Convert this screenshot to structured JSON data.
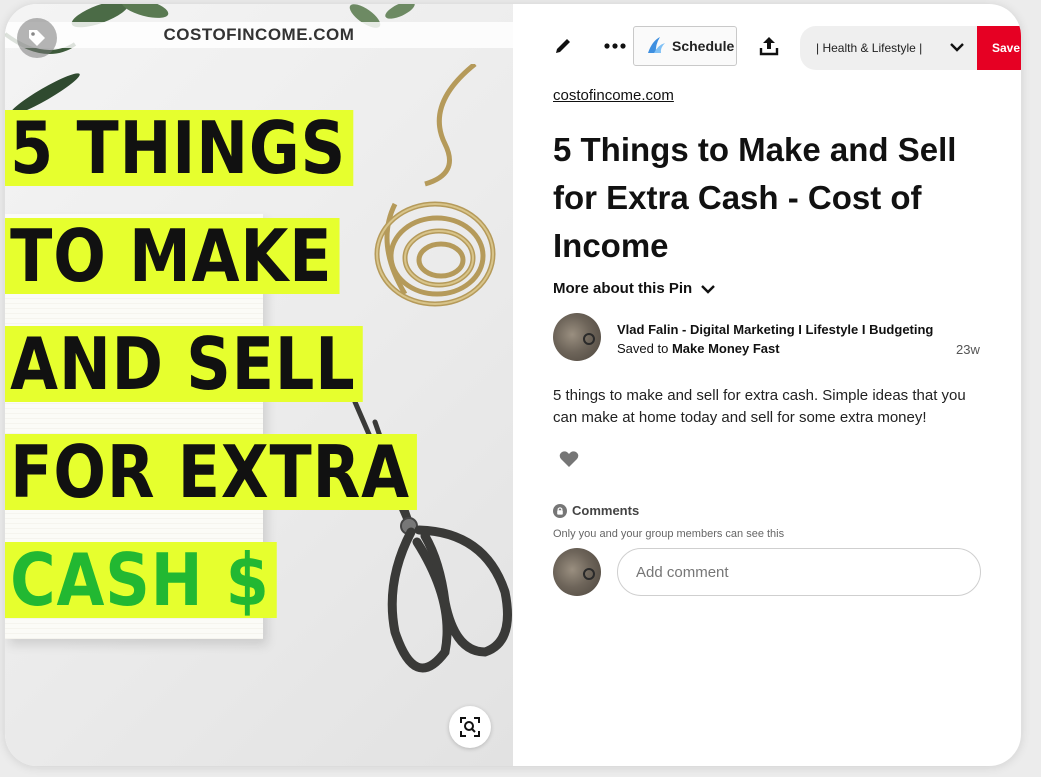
{
  "image": {
    "site_banner": "COSTOFINCOME.COM",
    "headline_lines": [
      "5 THINGS",
      "TO MAKE",
      "AND SELL",
      "FOR EXTRA",
      "CASH $"
    ],
    "highlight_color": "#e6ff2e",
    "accent_green": "#22b832"
  },
  "toolbar": {
    "edit_icon": "pencil-icon",
    "more_icon": "ellipsis-icon",
    "schedule_label": "Schedule",
    "share_icon": "upload-icon",
    "board_value": "| Health & Lifestyle |",
    "save_label": "Save",
    "save_color": "#e60023"
  },
  "pin": {
    "source": "costofincome.com",
    "title": "5 Things to Make and Sell for Extra Cash - Cost of Income",
    "more_about": "More about this Pin",
    "author": "Vlad Falin - Digital Marketing I Lifestyle I Budgeting",
    "saved_prefix": "Saved to ",
    "saved_board": "Make Money Fast",
    "age": "23w",
    "description": "5 things to make and sell for extra cash. Simple ideas that you can make at home today and sell for some extra money!"
  },
  "comments": {
    "heading": "Comments",
    "note": "Only you and your group members can see this",
    "placeholder": "Add comment"
  }
}
